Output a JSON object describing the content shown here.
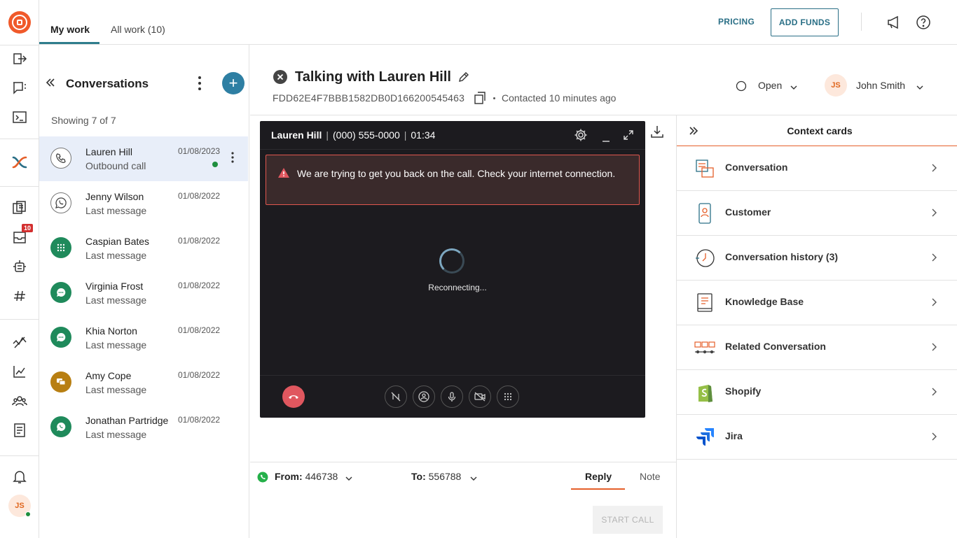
{
  "rail": {
    "avatar_initials": "JS",
    "badge_count": "10"
  },
  "topbar": {
    "tabs": [
      {
        "label": "My work"
      },
      {
        "label": "All work (10)"
      }
    ],
    "pricing_label": "PRICING",
    "add_funds_label": "ADD FUNDS"
  },
  "conversations": {
    "title": "Conversations",
    "showing": "Showing 7 of 7",
    "items": [
      {
        "name": "Lauren Hill",
        "sub": "Outbound call",
        "date": "01/08/2023"
      },
      {
        "name": "Jenny Wilson",
        "sub": "Last message",
        "date": "01/08/2022"
      },
      {
        "name": "Caspian Bates",
        "sub": "Last message",
        "date": "01/08/2022"
      },
      {
        "name": "Virginia Frost",
        "sub": "Last message",
        "date": "01/08/2022"
      },
      {
        "name": "Khia Norton",
        "sub": "Last message",
        "date": "01/08/2022"
      },
      {
        "name": "Amy Cope",
        "sub": "Last message",
        "date": "01/08/2022"
      },
      {
        "name": "Jonathan Partridge",
        "sub": "Last message",
        "date": "01/08/2022"
      }
    ]
  },
  "header": {
    "title": "Talking with Lauren Hill",
    "conversation_id": "FDD62E4F7BBB1582DB0D166200545463",
    "contacted": "Contacted 10 minutes ago",
    "status": "Open",
    "assignee_initials": "JS",
    "assignee": "John Smith"
  },
  "call": {
    "name": "Lauren Hill",
    "phone": "(000) 555-0000",
    "duration": "01:34",
    "alert": "We are trying to get you back on the call. Check your internet connection.",
    "status_text": "Reconnecting..."
  },
  "composer": {
    "from_label": "From:",
    "from_value": "446738",
    "to_label": "To:",
    "to_value": "556788",
    "reply_tab": "Reply",
    "note_tab": "Note",
    "start_call": "START CALL"
  },
  "context": {
    "title": "Context cards",
    "cards": [
      {
        "label": "Conversation"
      },
      {
        "label": "Customer"
      },
      {
        "label": "Conversation history (3)"
      },
      {
        "label": "Knowledge Base"
      },
      {
        "label": "Related Conversation"
      },
      {
        "label": "Shopify"
      },
      {
        "label": "Jira"
      }
    ]
  },
  "colors": {
    "accent": "#e55f2a",
    "brand_teal": "#2a6f86",
    "online": "#1e8e3e",
    "whatsapp_green": "#1f8a5b",
    "call_bg": "#1c1b1f"
  }
}
